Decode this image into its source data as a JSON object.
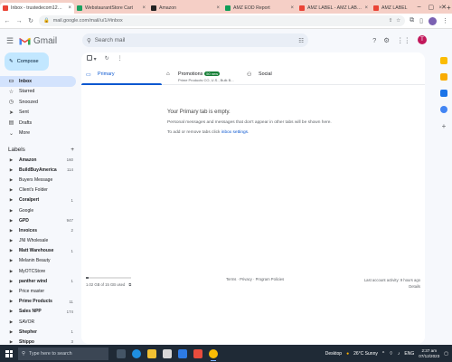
{
  "browser": {
    "tabs": [
      {
        "title": "Inbox - trustedecom12@...",
        "favicon_color": "#ea4335",
        "active": true
      },
      {
        "title": "WebstaurantStore Cart",
        "favicon_color": "#1aa260",
        "active": false
      },
      {
        "title": "Amazon",
        "favicon_color": "#222222",
        "active": false
      },
      {
        "title": "AMZ EOD Report",
        "favicon_color": "#0f9d58",
        "active": false
      },
      {
        "title": "AMZ LABEL - AMZ LABEL",
        "favicon_color": "#ea4335",
        "active": false
      },
      {
        "title": "AMZ LABEL",
        "favicon_color": "#ea4335",
        "active": false
      }
    ],
    "new_tab": "+",
    "url": "mail.google.com/mail/u/1/#inbox"
  },
  "gmail": {
    "logo_text": "Gmail",
    "search_placeholder": "Search mail",
    "compose_label": "Compose",
    "nav": [
      {
        "label": "Inbox",
        "icon": "inbox-icon",
        "glyph": "▭",
        "active": true
      },
      {
        "label": "Starred",
        "icon": "star-icon",
        "glyph": "☆",
        "active": false
      },
      {
        "label": "Snoozed",
        "icon": "clock-icon",
        "glyph": "◷",
        "active": false
      },
      {
        "label": "Sent",
        "icon": "send-icon",
        "glyph": "➤",
        "active": false
      },
      {
        "label": "Drafts",
        "icon": "draft-icon",
        "glyph": "▤",
        "active": false
      },
      {
        "label": "More",
        "icon": "chevron-down-icon",
        "glyph": "⌄",
        "active": false
      }
    ],
    "labels_title": "Labels",
    "labels_add": "+",
    "labels": [
      {
        "name": "Amazon",
        "count": "160",
        "bold": true
      },
      {
        "name": "BuildBuyAmerica",
        "count": "114",
        "bold": true
      },
      {
        "name": "Buyers Message",
        "count": "",
        "bold": false
      },
      {
        "name": "Client's Folder",
        "count": "",
        "bold": false
      },
      {
        "name": "Coralpert",
        "count": "1",
        "bold": true
      },
      {
        "name": "Google",
        "count": "",
        "bold": false
      },
      {
        "name": "GPD",
        "count": "947",
        "bold": true
      },
      {
        "name": "Invoices",
        "count": "2",
        "bold": true
      },
      {
        "name": "JNI Wholesale",
        "count": "",
        "bold": false
      },
      {
        "name": "Matt Warehouse",
        "count": "1",
        "bold": true
      },
      {
        "name": "Melanin Beauty",
        "count": "",
        "bold": false
      },
      {
        "name": "MyOTCStore",
        "count": "",
        "bold": false
      },
      {
        "name": "panther wind",
        "count": "1",
        "bold": true
      },
      {
        "name": "Price master",
        "count": "",
        "bold": false
      },
      {
        "name": "Prime Products",
        "count": "11",
        "bold": true
      },
      {
        "name": "Sales NPP",
        "count": "174",
        "bold": true
      },
      {
        "name": "SAVOR",
        "count": "",
        "bold": false
      },
      {
        "name": "Shepher",
        "count": "1",
        "bold": true
      },
      {
        "name": "Shippo",
        "count": "3",
        "bold": true
      }
    ],
    "inbox_tabs": [
      {
        "label": "Primary",
        "sub": "",
        "badge": "",
        "icon": "inbox-icon",
        "glyph": "▭",
        "active": true
      },
      {
        "label": "Promotions",
        "sub": "Prime Products CO, U.S., Bulk B...",
        "badge": "50 new",
        "icon": "tag-icon",
        "glyph": "⌂",
        "active": false
      },
      {
        "label": "Social",
        "sub": "",
        "badge": "",
        "icon": "people-icon",
        "glyph": "⚇",
        "active": false
      }
    ],
    "empty_state": {
      "heading": "Your Primary tab is empty.",
      "line1": "Personal messages and messages that don't appear in other tabs will be shown here.",
      "line2_prefix": "To add or remove tabs click",
      "line2_link": "inbox settings",
      "line2_suffix": "."
    },
    "footer": {
      "storage": "1.02 GB of 15 GB used",
      "storage_fraction": 0.068,
      "terms": "Terms · Privacy · Program Policies",
      "activity": "Last account activity: 9 hours ago",
      "details": "Details"
    }
  },
  "taskbar": {
    "search_placeholder": "Type here to search",
    "desktop_label": "Desktop",
    "weather": "26°C  Sunny",
    "lang": "ENG",
    "time": "2:37 am",
    "date": "07/12/2023"
  }
}
